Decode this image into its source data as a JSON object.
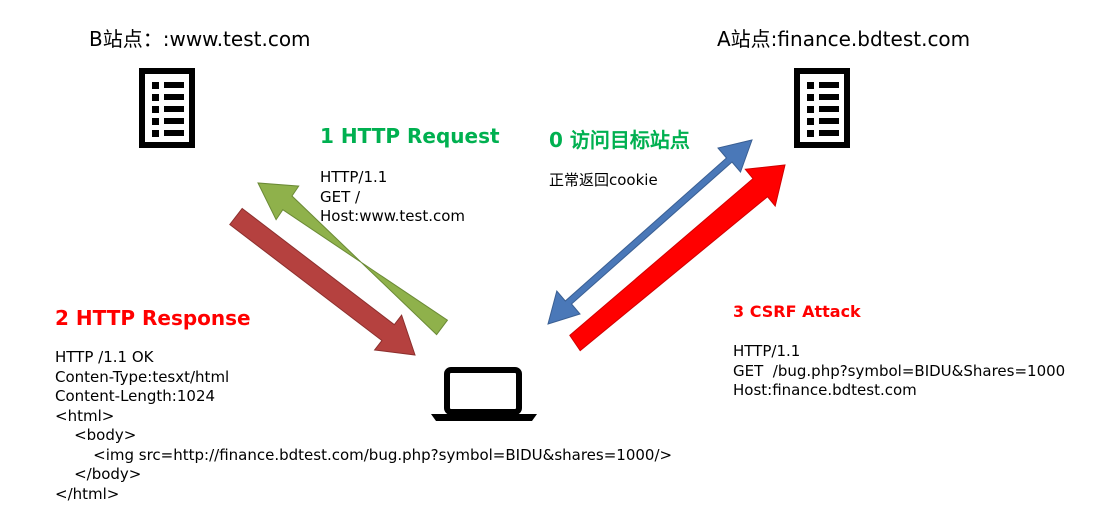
{
  "sites": {
    "b_label": "B站点：:www.test.com",
    "a_label": "A站点:finance.bdtest.com"
  },
  "steps": {
    "visit": {
      "title": "0  访问目标站点",
      "note": "正常返回cookie"
    },
    "request": {
      "title": "1   HTTP Request",
      "lines": [
        "HTTP/1.1",
        "GET /",
        "Host:www.test.com"
      ]
    },
    "response": {
      "title": "2   HTTP Response",
      "lines": [
        "HTTP /1.1 OK",
        "Conten-Type:tesxt/html",
        "Content-Length:1024",
        "<html>",
        "    <body>",
        "        <img src=http://finance.bdtest.com/bug.php?symbol=BIDU&shares=1000/>",
        "    </body>",
        "</html>"
      ]
    },
    "attack": {
      "title": "3   CSRF Attack",
      "lines": [
        "HTTP/1.1",
        "GET  /bug.php?symbol=BIDU&Shares=1000",
        "Host:finance.bdtest.com"
      ]
    }
  },
  "icons": {
    "server_b": "document-list-icon",
    "server_a": "document-list-icon",
    "client": "laptop-icon"
  },
  "colors": {
    "green_arrow": "#8fb14b",
    "dark_red_arrow": "#b5413f",
    "blue_arrow": "#4a78b8",
    "red_arrow": "#ff0000",
    "green_text": "#00b050",
    "red_text": "#ff0000"
  }
}
